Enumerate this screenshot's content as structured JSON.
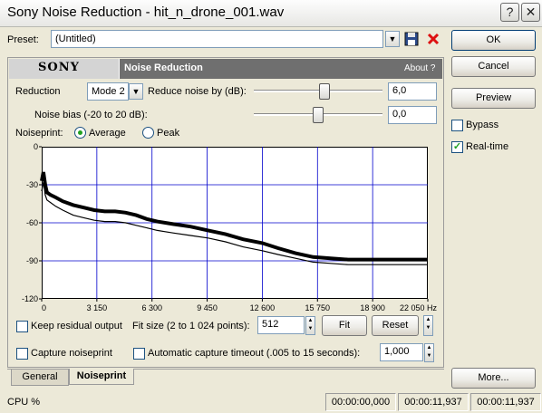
{
  "window": {
    "title": "Sony Noise Reduction - hit_n_drone_001.wav",
    "help_glyph": "?",
    "close_glyph": "✕"
  },
  "preset": {
    "label": "Preset:",
    "value": "(Untitled)"
  },
  "buttons": {
    "ok": "OK",
    "cancel": "Cancel",
    "preview": "Preview",
    "more": "More...",
    "fit": "Fit",
    "reset": "Reset"
  },
  "side_options": {
    "bypass": {
      "label": "Bypass",
      "checked": false
    },
    "realtime": {
      "label": "Real-time",
      "checked": true
    }
  },
  "header": {
    "brand": "SONY",
    "plugin_name": "Noise Reduction",
    "about": "About  ?"
  },
  "controls": {
    "reduction_label": "Reduction",
    "reduction_value": "Mode 2",
    "reduce_noise_label": "Reduce noise by (dB):",
    "reduce_noise_value": "6,0",
    "reduce_noise_slider": 0.55,
    "noise_bias_label": "Noise bias (-20 to 20 dB):",
    "noise_bias_value": "0,0",
    "noise_bias_slider": 0.5,
    "noiseprint_label": "Noiseprint:",
    "mode_average": "Average",
    "mode_peak": "Peak",
    "mode_selected": "Average"
  },
  "options": {
    "keep_residual": {
      "label": "Keep residual output",
      "checked": false
    },
    "fit_size_label": "Fit size (2 to 1 024 points):",
    "fit_size_value": "512",
    "capture_noiseprint": {
      "label": "Capture noiseprint",
      "checked": false
    },
    "auto_capture": {
      "label": "Automatic capture timeout (.005 to 15 seconds):",
      "checked": false
    },
    "timeout_value": "1,000"
  },
  "tabs": [
    {
      "label": "General",
      "active": false
    },
    {
      "label": "Noiseprint",
      "active": true
    }
  ],
  "status": {
    "cpu": "CPU %",
    "time1": "00:00:00,000",
    "time2": "00:00:11,937",
    "time3": "00:00:11,937"
  },
  "chart_data": {
    "type": "line",
    "title": "",
    "xlabel": "",
    "ylabel": "",
    "x_ticks": [
      "0",
      "3 150",
      "6 300",
      "9 450",
      "12 600",
      "15 750",
      "18 900",
      "22 050 Hz"
    ],
    "y_ticks": [
      "0",
      "-30",
      "-60",
      "-90",
      "-120"
    ],
    "xlim": [
      0,
      22050
    ],
    "ylim": [
      -120,
      0
    ],
    "grid": true,
    "colors": {
      "line": "#000000",
      "grid": "#0000cc"
    },
    "series": [
      {
        "x": [
          0,
          100,
          200,
          300,
          500,
          800,
          1200,
          1800,
          2400,
          3000,
          3600,
          4200,
          4800,
          5400,
          6000,
          6600,
          7500,
          8500,
          9500,
          10500,
          11500,
          12600,
          13500,
          14500,
          15500,
          16500,
          17500,
          18900,
          20000,
          21000,
          22050
        ],
        "values": [
          -27,
          -20,
          -30,
          -36,
          -38,
          -40,
          -43,
          -46,
          -48,
          -50,
          -51,
          -51,
          -52,
          -54,
          -57,
          -59,
          -61,
          -63,
          -66,
          -69,
          -73,
          -76,
          -80,
          -84,
          -87,
          -88,
          -89,
          -89,
          -89,
          -89,
          -89
        ]
      },
      {
        "x": [
          0,
          100,
          200,
          300,
          500,
          800,
          1200,
          1800,
          2400,
          3000,
          3600,
          4200,
          4800,
          5400,
          6000,
          6600,
          7500,
          8500,
          9500,
          10500,
          11500,
          12600,
          13500,
          14500,
          15500,
          16500,
          17500,
          18900,
          20000,
          21000,
          22050
        ],
        "values": [
          -35,
          -28,
          -38,
          -42,
          -44,
          -47,
          -50,
          -54,
          -56,
          -58,
          -59,
          -59,
          -60,
          -62,
          -64,
          -66,
          -68,
          -70,
          -72,
          -75,
          -79,
          -82,
          -85,
          -88,
          -91,
          -92,
          -93,
          -93,
          -93,
          -93,
          -93
        ]
      }
    ]
  }
}
